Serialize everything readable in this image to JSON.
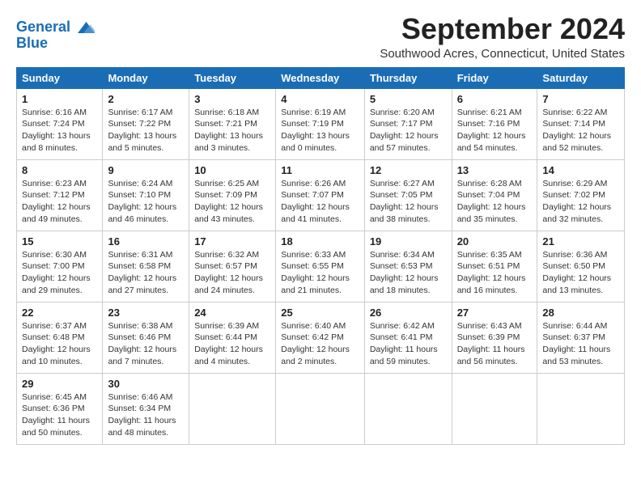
{
  "header": {
    "logo_line1": "General",
    "logo_line2": "Blue",
    "month": "September 2024",
    "location": "Southwood Acres, Connecticut, United States"
  },
  "days_of_week": [
    "Sunday",
    "Monday",
    "Tuesday",
    "Wednesday",
    "Thursday",
    "Friday",
    "Saturday"
  ],
  "weeks": [
    [
      {
        "day": "1",
        "sunrise": "6:16 AM",
        "sunset": "7:24 PM",
        "daylight": "13 hours and 8 minutes."
      },
      {
        "day": "2",
        "sunrise": "6:17 AM",
        "sunset": "7:22 PM",
        "daylight": "13 hours and 5 minutes."
      },
      {
        "day": "3",
        "sunrise": "6:18 AM",
        "sunset": "7:21 PM",
        "daylight": "13 hours and 3 minutes."
      },
      {
        "day": "4",
        "sunrise": "6:19 AM",
        "sunset": "7:19 PM",
        "daylight": "13 hours and 0 minutes."
      },
      {
        "day": "5",
        "sunrise": "6:20 AM",
        "sunset": "7:17 PM",
        "daylight": "12 hours and 57 minutes."
      },
      {
        "day": "6",
        "sunrise": "6:21 AM",
        "sunset": "7:16 PM",
        "daylight": "12 hours and 54 minutes."
      },
      {
        "day": "7",
        "sunrise": "6:22 AM",
        "sunset": "7:14 PM",
        "daylight": "12 hours and 52 minutes."
      }
    ],
    [
      {
        "day": "8",
        "sunrise": "6:23 AM",
        "sunset": "7:12 PM",
        "daylight": "12 hours and 49 minutes."
      },
      {
        "day": "9",
        "sunrise": "6:24 AM",
        "sunset": "7:10 PM",
        "daylight": "12 hours and 46 minutes."
      },
      {
        "day": "10",
        "sunrise": "6:25 AM",
        "sunset": "7:09 PM",
        "daylight": "12 hours and 43 minutes."
      },
      {
        "day": "11",
        "sunrise": "6:26 AM",
        "sunset": "7:07 PM",
        "daylight": "12 hours and 41 minutes."
      },
      {
        "day": "12",
        "sunrise": "6:27 AM",
        "sunset": "7:05 PM",
        "daylight": "12 hours and 38 minutes."
      },
      {
        "day": "13",
        "sunrise": "6:28 AM",
        "sunset": "7:04 PM",
        "daylight": "12 hours and 35 minutes."
      },
      {
        "day": "14",
        "sunrise": "6:29 AM",
        "sunset": "7:02 PM",
        "daylight": "12 hours and 32 minutes."
      }
    ],
    [
      {
        "day": "15",
        "sunrise": "6:30 AM",
        "sunset": "7:00 PM",
        "daylight": "12 hours and 29 minutes."
      },
      {
        "day": "16",
        "sunrise": "6:31 AM",
        "sunset": "6:58 PM",
        "daylight": "12 hours and 27 minutes."
      },
      {
        "day": "17",
        "sunrise": "6:32 AM",
        "sunset": "6:57 PM",
        "daylight": "12 hours and 24 minutes."
      },
      {
        "day": "18",
        "sunrise": "6:33 AM",
        "sunset": "6:55 PM",
        "daylight": "12 hours and 21 minutes."
      },
      {
        "day": "19",
        "sunrise": "6:34 AM",
        "sunset": "6:53 PM",
        "daylight": "12 hours and 18 minutes."
      },
      {
        "day": "20",
        "sunrise": "6:35 AM",
        "sunset": "6:51 PM",
        "daylight": "12 hours and 16 minutes."
      },
      {
        "day": "21",
        "sunrise": "6:36 AM",
        "sunset": "6:50 PM",
        "daylight": "12 hours and 13 minutes."
      }
    ],
    [
      {
        "day": "22",
        "sunrise": "6:37 AM",
        "sunset": "6:48 PM",
        "daylight": "12 hours and 10 minutes."
      },
      {
        "day": "23",
        "sunrise": "6:38 AM",
        "sunset": "6:46 PM",
        "daylight": "12 hours and 7 minutes."
      },
      {
        "day": "24",
        "sunrise": "6:39 AM",
        "sunset": "6:44 PM",
        "daylight": "12 hours and 4 minutes."
      },
      {
        "day": "25",
        "sunrise": "6:40 AM",
        "sunset": "6:42 PM",
        "daylight": "12 hours and 2 minutes."
      },
      {
        "day": "26",
        "sunrise": "6:42 AM",
        "sunset": "6:41 PM",
        "daylight": "11 hours and 59 minutes."
      },
      {
        "day": "27",
        "sunrise": "6:43 AM",
        "sunset": "6:39 PM",
        "daylight": "11 hours and 56 minutes."
      },
      {
        "day": "28",
        "sunrise": "6:44 AM",
        "sunset": "6:37 PM",
        "daylight": "11 hours and 53 minutes."
      }
    ],
    [
      {
        "day": "29",
        "sunrise": "6:45 AM",
        "sunset": "6:36 PM",
        "daylight": "11 hours and 50 minutes."
      },
      {
        "day": "30",
        "sunrise": "6:46 AM",
        "sunset": "6:34 PM",
        "daylight": "11 hours and 48 minutes."
      },
      null,
      null,
      null,
      null,
      null
    ]
  ],
  "labels": {
    "sunrise": "Sunrise:",
    "sunset": "Sunset:",
    "daylight": "Daylight:"
  }
}
